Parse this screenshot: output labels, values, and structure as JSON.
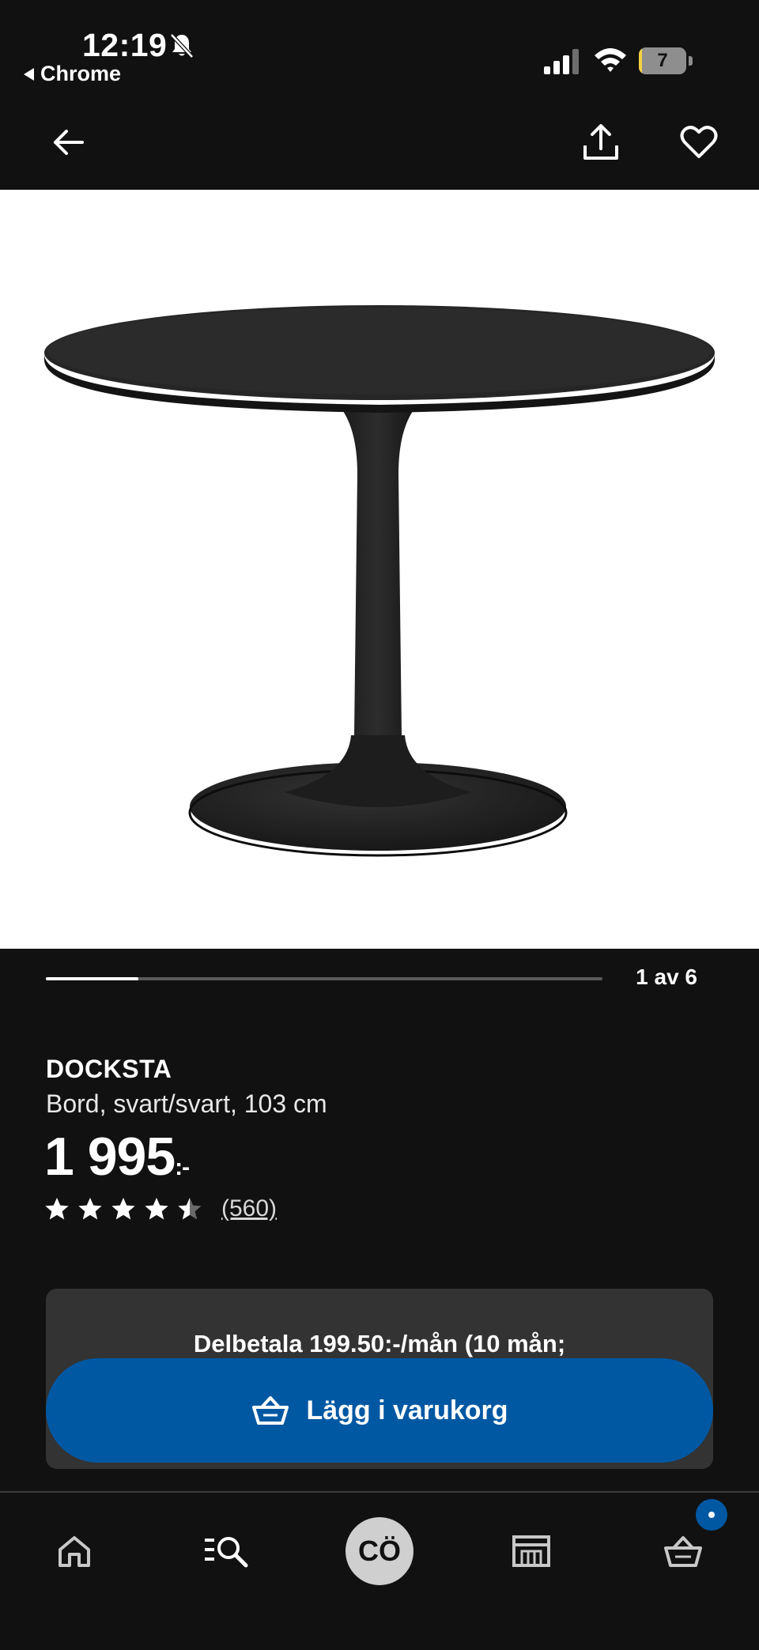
{
  "status_bar": {
    "time": "12:19",
    "back_app": "Chrome",
    "battery_level": "7",
    "battery_fraction": 0.07,
    "icons": [
      "bell-slash-icon",
      "signal-icon",
      "wifi-icon",
      "battery-icon"
    ]
  },
  "top_nav": {
    "icons": [
      "arrow-left-icon",
      "share-icon",
      "heart-icon"
    ]
  },
  "carousel": {
    "counter": "1 av 6",
    "current": 1,
    "total": 6,
    "progress_fraction": 0.1667
  },
  "product": {
    "name": "DOCKSTA",
    "description": "Bord, svart/svart, 103 cm",
    "price": "1 995",
    "price_suffix": ":-",
    "rating": 4.5,
    "rating_max": 5,
    "review_count": "(560)"
  },
  "installment": {
    "text": "Delbetala 199.50:-/mån (10 mån;"
  },
  "cta": {
    "label": "Lägg i varukorg",
    "icon": "basket-icon",
    "color": "#0058a3"
  },
  "tab_bar": {
    "items": [
      {
        "name": "home",
        "icon": "home-icon"
      },
      {
        "name": "search",
        "icon": "search-list-icon"
      },
      {
        "name": "profile",
        "avatar_initials": "CÖ"
      },
      {
        "name": "store",
        "icon": "store-icon"
      },
      {
        "name": "cart",
        "icon": "basket-icon",
        "badge": true
      }
    ]
  },
  "colors": {
    "background": "#111111",
    "accent": "#0058a3",
    "card": "#333333"
  }
}
